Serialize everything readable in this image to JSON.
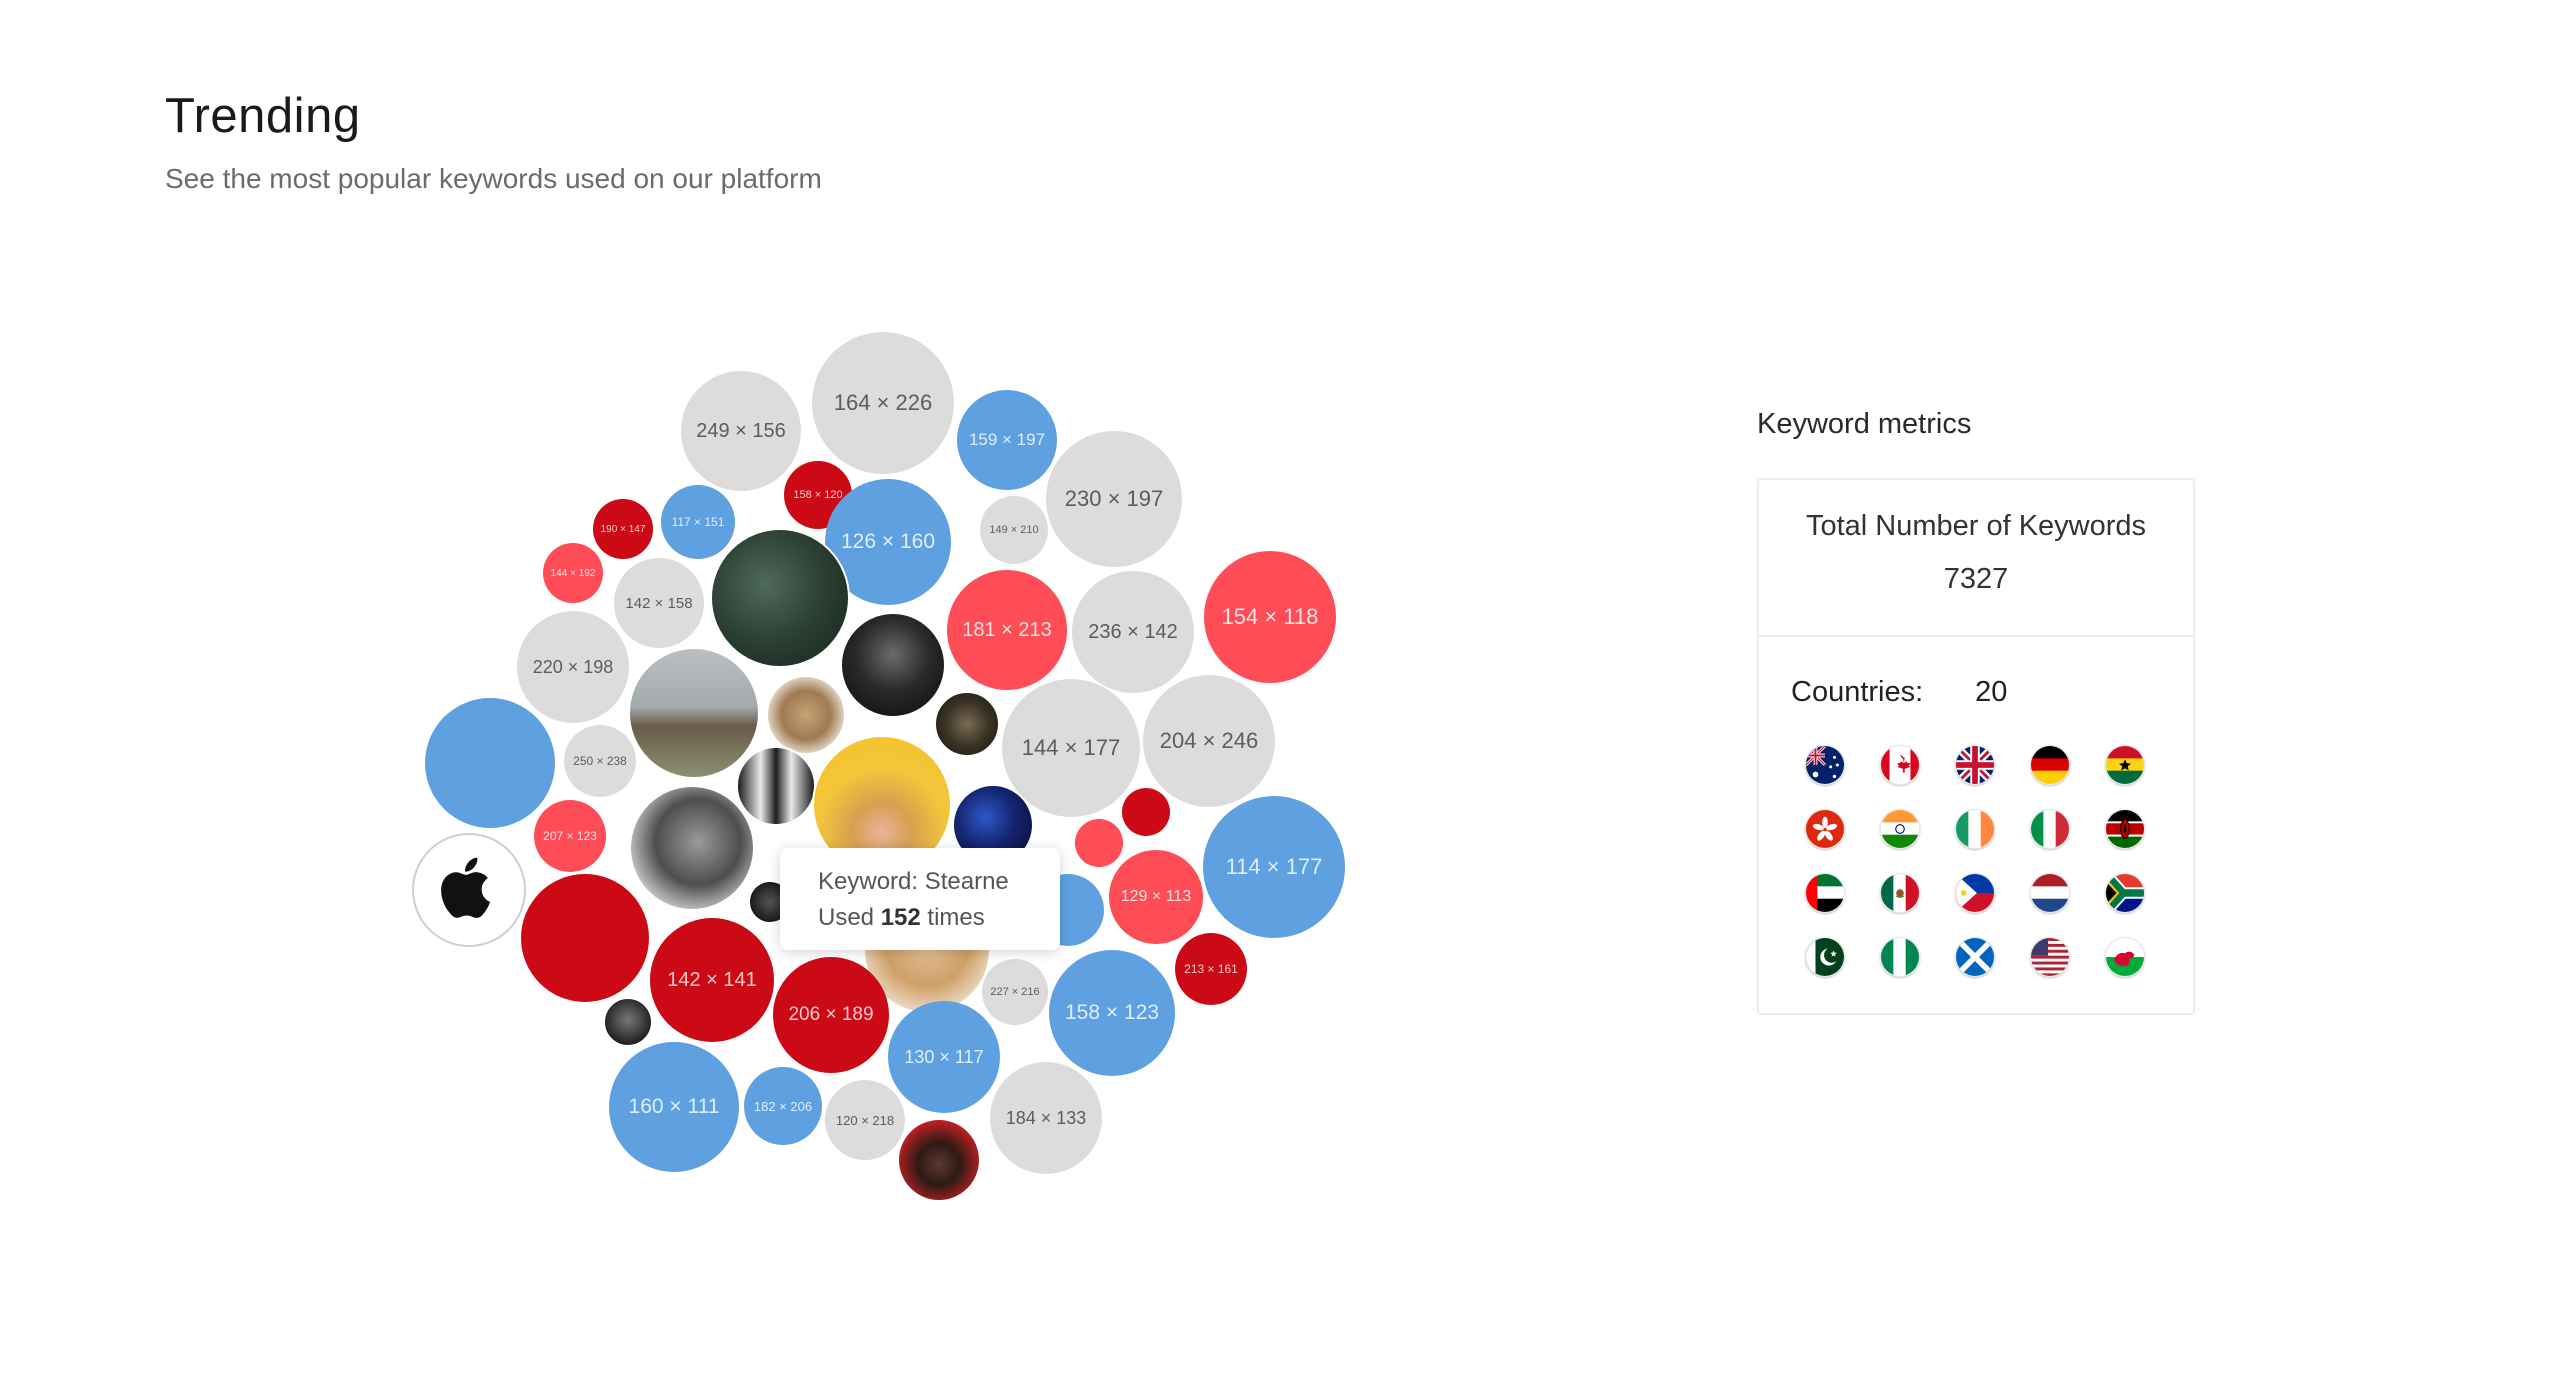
{
  "header": {
    "title": "Trending",
    "subtitle": "See the most popular keywords used on our platform"
  },
  "bubbles": [
    {
      "label": "249 × 156",
      "kind": "gray"
    },
    {
      "label": "164 × 226",
      "kind": "gray"
    },
    {
      "label": "159 × 197",
      "kind": "blue"
    },
    {
      "label": "230 × 197",
      "kind": "gray"
    },
    {
      "label": "158 × 120",
      "kind": "dred"
    },
    {
      "label": "190 × 147",
      "kind": "dred"
    },
    {
      "label": "117 × 151",
      "kind": "blue"
    },
    {
      "label": "126 × 160",
      "kind": "blue"
    },
    {
      "label": "149 × 210",
      "kind": "gray"
    },
    {
      "label": "144 × 192",
      "kind": "red"
    },
    {
      "label": "142 × 158",
      "kind": "gray"
    },
    {
      "label": "",
      "kind": "photo",
      "theme": "forest"
    },
    {
      "label": "181 × 213",
      "kind": "red"
    },
    {
      "label": "236 × 142",
      "kind": "gray"
    },
    {
      "label": "154 × 118",
      "kind": "red"
    },
    {
      "label": "220 × 198",
      "kind": "gray"
    },
    {
      "label": "",
      "kind": "photo",
      "theme": "house"
    },
    {
      "label": "",
      "kind": "photo",
      "theme": "pug"
    },
    {
      "label": "",
      "kind": "photo",
      "theme": "dark-hands"
    },
    {
      "label": "",
      "kind": "photo",
      "theme": "leaves"
    },
    {
      "label": "144 × 177",
      "kind": "gray"
    },
    {
      "label": "204 × 246",
      "kind": "gray"
    },
    {
      "label": "",
      "kind": "blue"
    },
    {
      "label": "250 × 238",
      "kind": "gray"
    },
    {
      "label": "",
      "kind": "photo",
      "theme": "bw-man"
    },
    {
      "label": "",
      "kind": "photo",
      "theme": "yellow-woman"
    },
    {
      "label": "",
      "kind": "photo",
      "theme": "blue-night"
    },
    {
      "label": "",
      "kind": "dred"
    },
    {
      "label": "",
      "kind": "red"
    },
    {
      "label": "207 × 123",
      "kind": "red"
    },
    {
      "label": "",
      "kind": "photo",
      "theme": "bw-portrait"
    },
    {
      "label": "129 × 113",
      "kind": "red"
    },
    {
      "label": "114 × 177",
      "kind": "blue"
    },
    {
      "label": "",
      "kind": "apple-logo"
    },
    {
      "label": "",
      "kind": "dred"
    },
    {
      "label": "",
      "kind": "photo",
      "theme": "bw-small"
    },
    {
      "label": "142 × 141",
      "kind": "dred"
    },
    {
      "label": "",
      "kind": "photo",
      "theme": "blonde"
    },
    {
      "label": "",
      "kind": "blue"
    },
    {
      "label": "227 × 216",
      "kind": "gray"
    },
    {
      "label": "213 × 161",
      "kind": "dred"
    },
    {
      "label": "206 × 189",
      "kind": "dred"
    },
    {
      "label": "158 × 123",
      "kind": "blue"
    },
    {
      "label": "",
      "kind": "photo",
      "theme": "bw-tiny"
    },
    {
      "label": "130 × 117",
      "kind": "blue"
    },
    {
      "label": "160 × 111",
      "kind": "blue"
    },
    {
      "label": "182 × 206",
      "kind": "blue"
    },
    {
      "label": "120 × 218",
      "kind": "gray"
    },
    {
      "label": "184 × 133",
      "kind": "gray"
    },
    {
      "label": "",
      "kind": "photo",
      "theme": "red-portrait"
    }
  ],
  "tooltip": {
    "keyword_prefix": "Keyword:",
    "keyword": "Stearne",
    "used_prefix": "Used",
    "count": "152",
    "used_suffix": "times"
  },
  "metrics": {
    "title": "Keyword metrics",
    "total_label": "Total Number of Keywords",
    "total_value": "7327",
    "countries_label": "Countries:",
    "countries_value": "20",
    "flags": [
      "australia-flag",
      "canada-flag",
      "uk-flag",
      "germany-flag",
      "ghana-flag",
      "hong-kong-flag",
      "india-flag",
      "ireland-flag",
      "italy-flag",
      "kenya-flag",
      "uae-flag",
      "mexico-flag",
      "philippines-flag",
      "netherlands-flag",
      "south-africa-flag",
      "pakistan-flag",
      "nigeria-flag",
      "scotland-flag",
      "usa-flag",
      "wales-flag"
    ]
  }
}
